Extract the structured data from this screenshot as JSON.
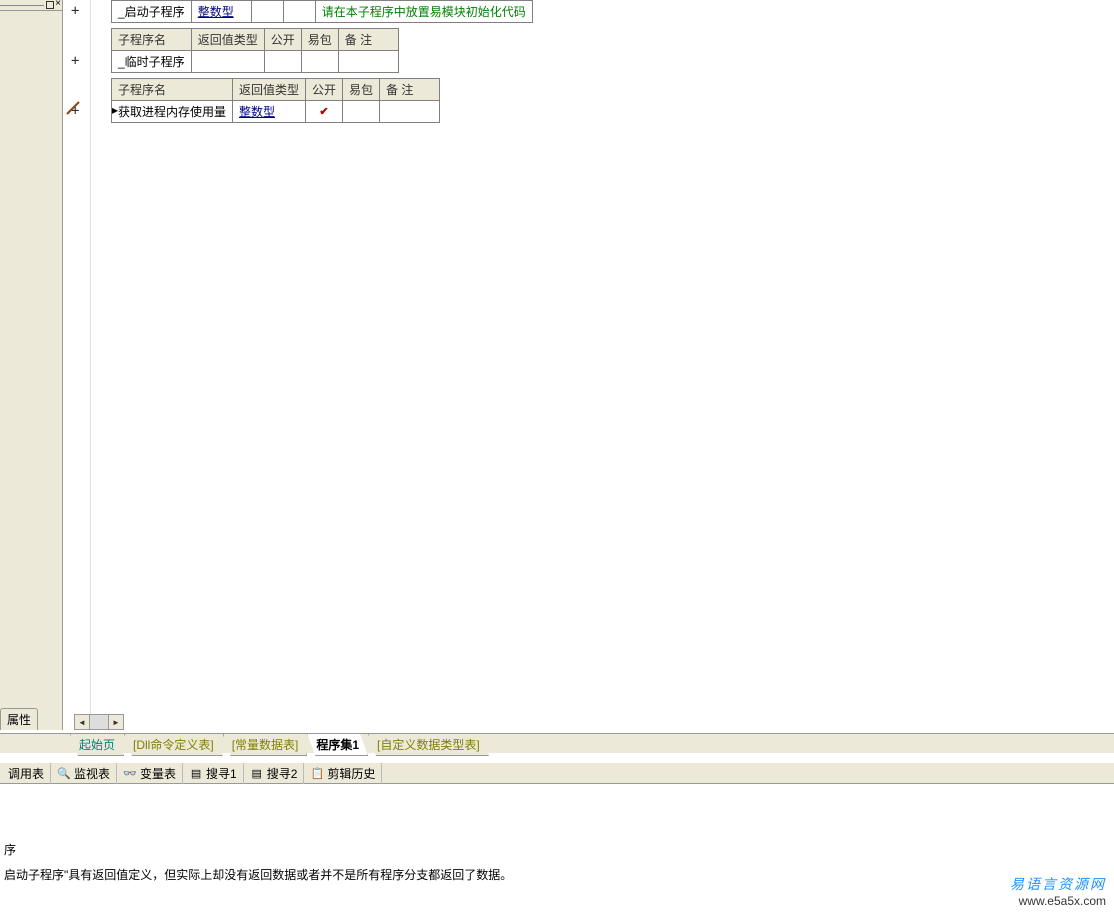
{
  "left_panel": {
    "property_tab": "属性"
  },
  "table1": {
    "row": {
      "name": "_启动子程序",
      "ret": "整数型",
      "comment": "请在本子程序中放置易模块初始化代码"
    }
  },
  "table2": {
    "headers": {
      "name": "子程序名",
      "ret": "返回值类型",
      "pub": "公开",
      "pkg": "易包",
      "remark": "备 注"
    },
    "row": {
      "name": "_临时子程序"
    }
  },
  "table3": {
    "headers": {
      "name": "子程序名",
      "ret": "返回值类型",
      "pub": "公开",
      "pkg": "易包",
      "remark": "备 注"
    },
    "row": {
      "name": "获取进程内存使用量",
      "ret": "整数型",
      "pub_checked": "✔"
    }
  },
  "tabs": {
    "start": "起始页",
    "dll": "[Dll命令定义表]",
    "const": "[常量数据表]",
    "prog": "程序集1",
    "custom": "[自定义数据类型表]"
  },
  "bottom_tabs": {
    "call": "调用表",
    "watch": "监视表",
    "var": "变量表",
    "search1": "搜寻1",
    "search2": "搜寻2",
    "clip": "剪辑历史"
  },
  "log": {
    "line1": "序",
    "line2": "启动子程序\"具有返回值定义，但实际上却没有返回数据或者并不是所有程序分支都返回了数据。"
  },
  "watermark": {
    "cn": "易语言资源网",
    "en": "www.e5a5x.com"
  },
  "gutter": {
    "plus": "+"
  }
}
